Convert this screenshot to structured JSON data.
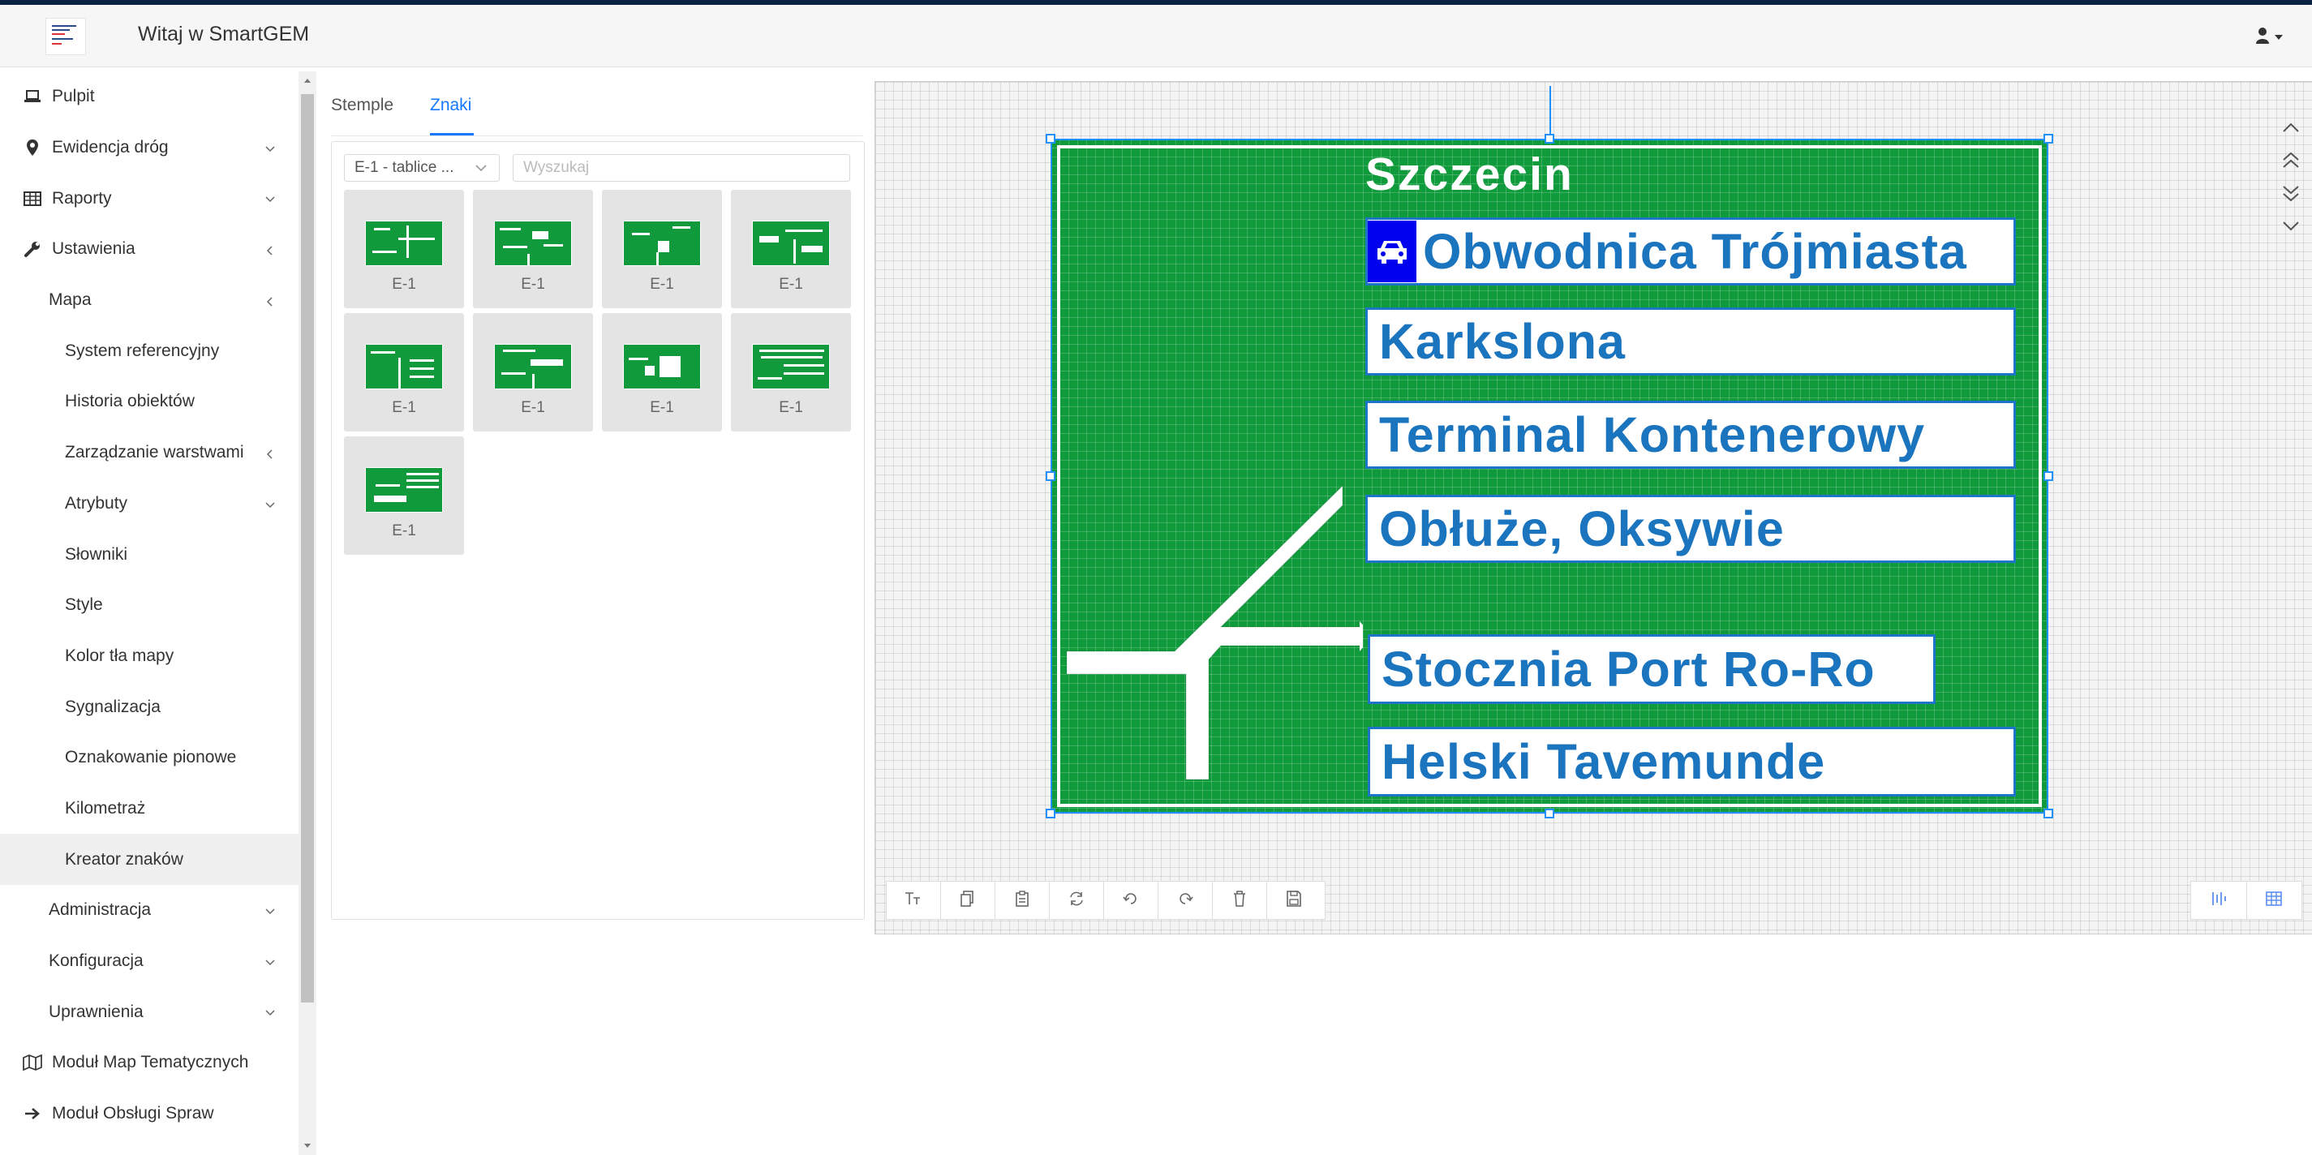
{
  "header": {
    "title": "Witaj w SmartGEM"
  },
  "sidebar": {
    "items": [
      {
        "label": "Pulpit",
        "icon": "laptop-icon"
      },
      {
        "label": "Ewidencja dróg",
        "icon": "map-marker-icon",
        "chevron": "down"
      },
      {
        "label": "Raporty",
        "icon": "table-icon",
        "chevron": "down"
      },
      {
        "label": "Ustawienia",
        "icon": "wrench-icon",
        "chevron": "left"
      },
      {
        "label": "Mapa",
        "chevron": "left"
      },
      {
        "label": "System referencyjny"
      },
      {
        "label": "Historia obiektów"
      },
      {
        "label": "Zarządzanie warstwami",
        "chevron": "left"
      },
      {
        "label": "Atrybuty",
        "chevron": "down"
      },
      {
        "label": "Słowniki"
      },
      {
        "label": "Style"
      },
      {
        "label": "Kolor tła mapy"
      },
      {
        "label": "Sygnalizacja"
      },
      {
        "label": "Oznakowanie pionowe"
      },
      {
        "label": "Kilometraż"
      },
      {
        "label": "Kreator znaków",
        "active": true
      },
      {
        "label": "Administracja",
        "chevron": "down"
      },
      {
        "label": "Konfiguracja",
        "chevron": "down"
      },
      {
        "label": "Uprawnienia",
        "chevron": "down"
      },
      {
        "label": "Moduł Map Tematycznych",
        "icon": "map-icon"
      },
      {
        "label": "Moduł Obsługi Spraw",
        "icon": "arrow-right-icon"
      }
    ]
  },
  "tabs": {
    "stemple": "Stemple",
    "znaki": "Znaki",
    "active": "Znaki"
  },
  "filter": {
    "selected": "E-1 - tablice ...",
    "search_placeholder": "Wyszukaj"
  },
  "thumbnails": [
    {
      "label": "E-1"
    },
    {
      "label": "E-1"
    },
    {
      "label": "E-1"
    },
    {
      "label": "E-1"
    },
    {
      "label": "E-1"
    },
    {
      "label": "E-1"
    },
    {
      "label": "E-1"
    },
    {
      "label": "E-1"
    },
    {
      "label": "E-1"
    }
  ],
  "sign": {
    "city": "Szczecin",
    "destinations": [
      "Obwodnica Trójmiasta",
      "Karkslona",
      "Terminal Kontenerowy",
      "Obłuże, Oksywie",
      "Stocznia Port Ro-Ro",
      "Helski Tavemunde"
    ],
    "colors": {
      "background": "#0f9a3c",
      "text": "#1b74be",
      "border": "#1e74c8",
      "car_box": "#0000ee"
    }
  },
  "toolbar": {
    "buttons": [
      "text-size-icon",
      "copy-icon",
      "paste-icon",
      "refresh-icon",
      "undo-icon",
      "redo-icon",
      "trash-icon",
      "save-icon"
    ],
    "right_buttons": [
      "align-vertical-icon",
      "grid-icon"
    ]
  },
  "zoom_buttons": [
    "chevron-up-icon",
    "double-chevron-up-icon",
    "double-chevron-down-icon",
    "chevron-down-icon"
  ]
}
